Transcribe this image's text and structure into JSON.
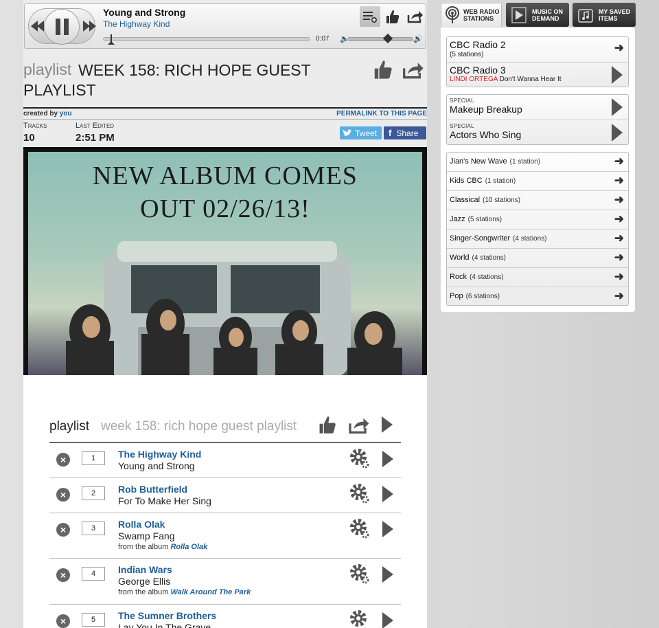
{
  "player": {
    "title": "Young and Strong",
    "artist": "The Highway Kind",
    "time": "0:07",
    "progress": 0.02,
    "volume": 0.62
  },
  "playlist_header": {
    "label": "playlist",
    "title": "WEEK 158: RICH HOPE GUEST PLAYLIST",
    "created_by_label": "created by",
    "created_by_user": "you",
    "permalink": "PERMALINK TO THIS PAGE",
    "tracks_label": "Tracks",
    "tracks_value": "10",
    "edited_label": "Last Edited",
    "edited_value": "2:51 PM",
    "tweet": "Tweet",
    "share": "Share"
  },
  "album_art": {
    "line1": "NEW ALBUM COMES",
    "line2": "OUT 02/26/13!"
  },
  "list": {
    "label": "playlist",
    "title": "week 158: rich hope guest playlist",
    "tracks": [
      {
        "num": "1",
        "artist": "The Highway Kind",
        "song": "Young and Strong",
        "album_prefix": "",
        "album": ""
      },
      {
        "num": "2",
        "artist": "Rob Butterfield",
        "song": "For To Make Her Sing",
        "album_prefix": "",
        "album": ""
      },
      {
        "num": "3",
        "artist": "Rolla Olak",
        "song": "Swamp Fang",
        "album_prefix": "from the album",
        "album": "Rolla Olak"
      },
      {
        "num": "4",
        "artist": "Indian Wars",
        "song": "George Ellis",
        "album_prefix": "from the album",
        "album": "Walk Around The Park"
      },
      {
        "num": "5",
        "artist": "The Sumner Brothers",
        "song": "Lay You In The Grave",
        "album_prefix": "",
        "album": ""
      }
    ]
  },
  "sidebar": {
    "tabs": [
      {
        "label": "WEB RADIO STATIONS",
        "icon": "radio-tower-icon"
      },
      {
        "label": "MUSIC ON DEMAND",
        "icon": "play-icon"
      },
      {
        "label": "MY SAVED ITEMS",
        "icon": "music-note-icon"
      }
    ],
    "radio": [
      {
        "name": "CBC Radio 2",
        "sub": "(5 stations)"
      },
      {
        "name": "CBC Radio 3",
        "artist": "LINDI ORTEGA",
        "song": "Don't Wanna Hear It"
      }
    ],
    "specials": [
      {
        "tag": "SPECIAL",
        "name": "Makeup Breakup"
      },
      {
        "tag": "SPECIAL",
        "name": "Actors Who Sing"
      }
    ],
    "genres": [
      {
        "name": "Jian's New Wave",
        "count": "(1 station)"
      },
      {
        "name": "Kids CBC",
        "count": "(1 station)"
      },
      {
        "name": "Classical",
        "count": "(10 stations)"
      },
      {
        "name": "Jazz",
        "count": "(5 stations)"
      },
      {
        "name": "Singer-Songwriter",
        "count": "(4 stations)"
      },
      {
        "name": "World",
        "count": "(4 stations)"
      },
      {
        "name": "Rock",
        "count": "(4 stations)"
      },
      {
        "name": "Pop",
        "count": "(6 stations)"
      }
    ]
  }
}
